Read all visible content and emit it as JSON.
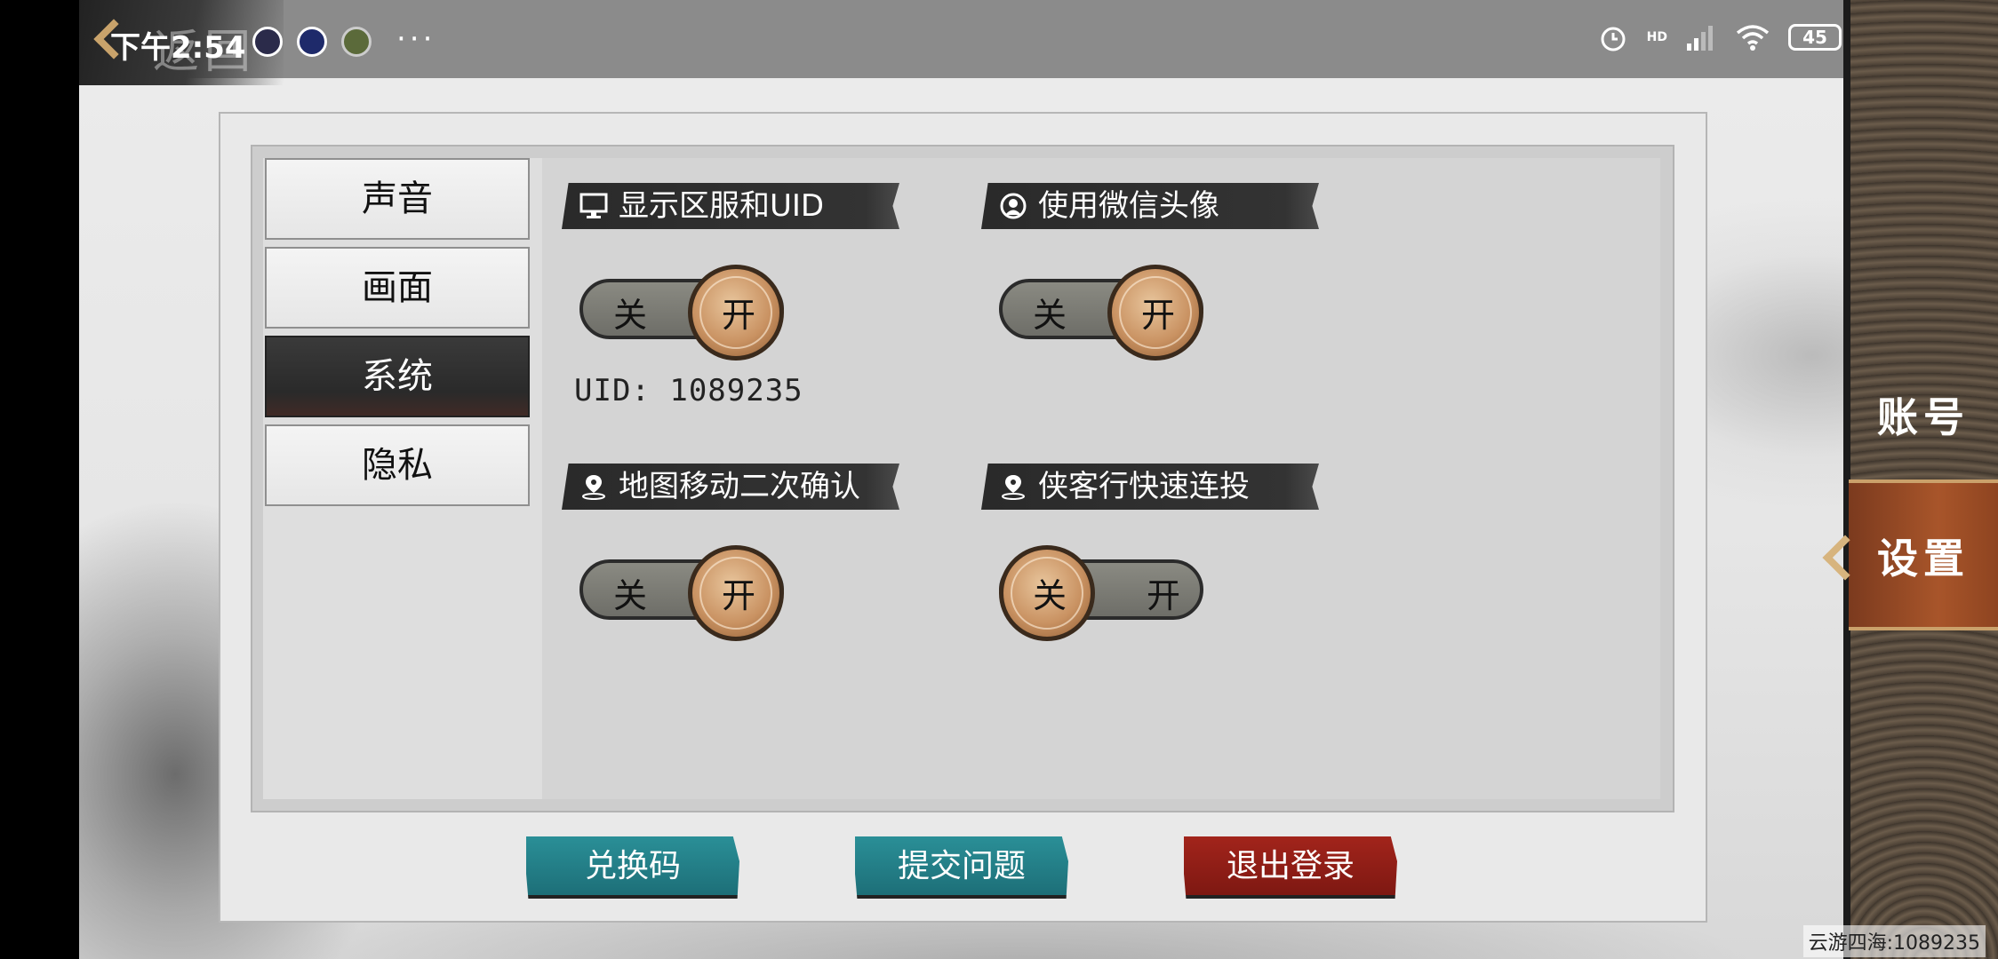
{
  "status_bar": {
    "time": "下午2:54",
    "more": "···",
    "signal": "HD",
    "battery": "45"
  },
  "header": {
    "back_label": "返回"
  },
  "right_nav": {
    "items": [
      {
        "label": "账号"
      },
      {
        "label": "设置"
      }
    ]
  },
  "settings": {
    "tabs": [
      {
        "label": "声音",
        "active": false
      },
      {
        "label": "画面",
        "active": false
      },
      {
        "label": "系统",
        "active": true
      },
      {
        "label": "隐私",
        "active": false
      }
    ],
    "sections": [
      {
        "title": "显示区服和UID",
        "icon": "monitor-icon",
        "state": "on",
        "off_label": "关",
        "on_label": "开"
      },
      {
        "title": "使用微信头像",
        "icon": "avatar-icon",
        "state": "on",
        "off_label": "关",
        "on_label": "开"
      },
      {
        "title": "地图移动二次确认",
        "icon": "location-pin-icon",
        "state": "on",
        "off_label": "关",
        "on_label": "开"
      },
      {
        "title": "侠客行快速连投",
        "icon": "location-pin-icon",
        "state": "off",
        "off_label": "关",
        "on_label": "开"
      }
    ],
    "uid_text": "UID: 1089235"
  },
  "buttons": {
    "redeem": "兑换码",
    "submit_issue": "提交问题",
    "logout": "退出登录"
  },
  "watermark": "云游四海:1089235",
  "colors": {
    "teal_button": "#1d6f78",
    "red_button": "#7e1812",
    "active_tab": "#2a2a2a",
    "accent_gold": "#c99262"
  }
}
